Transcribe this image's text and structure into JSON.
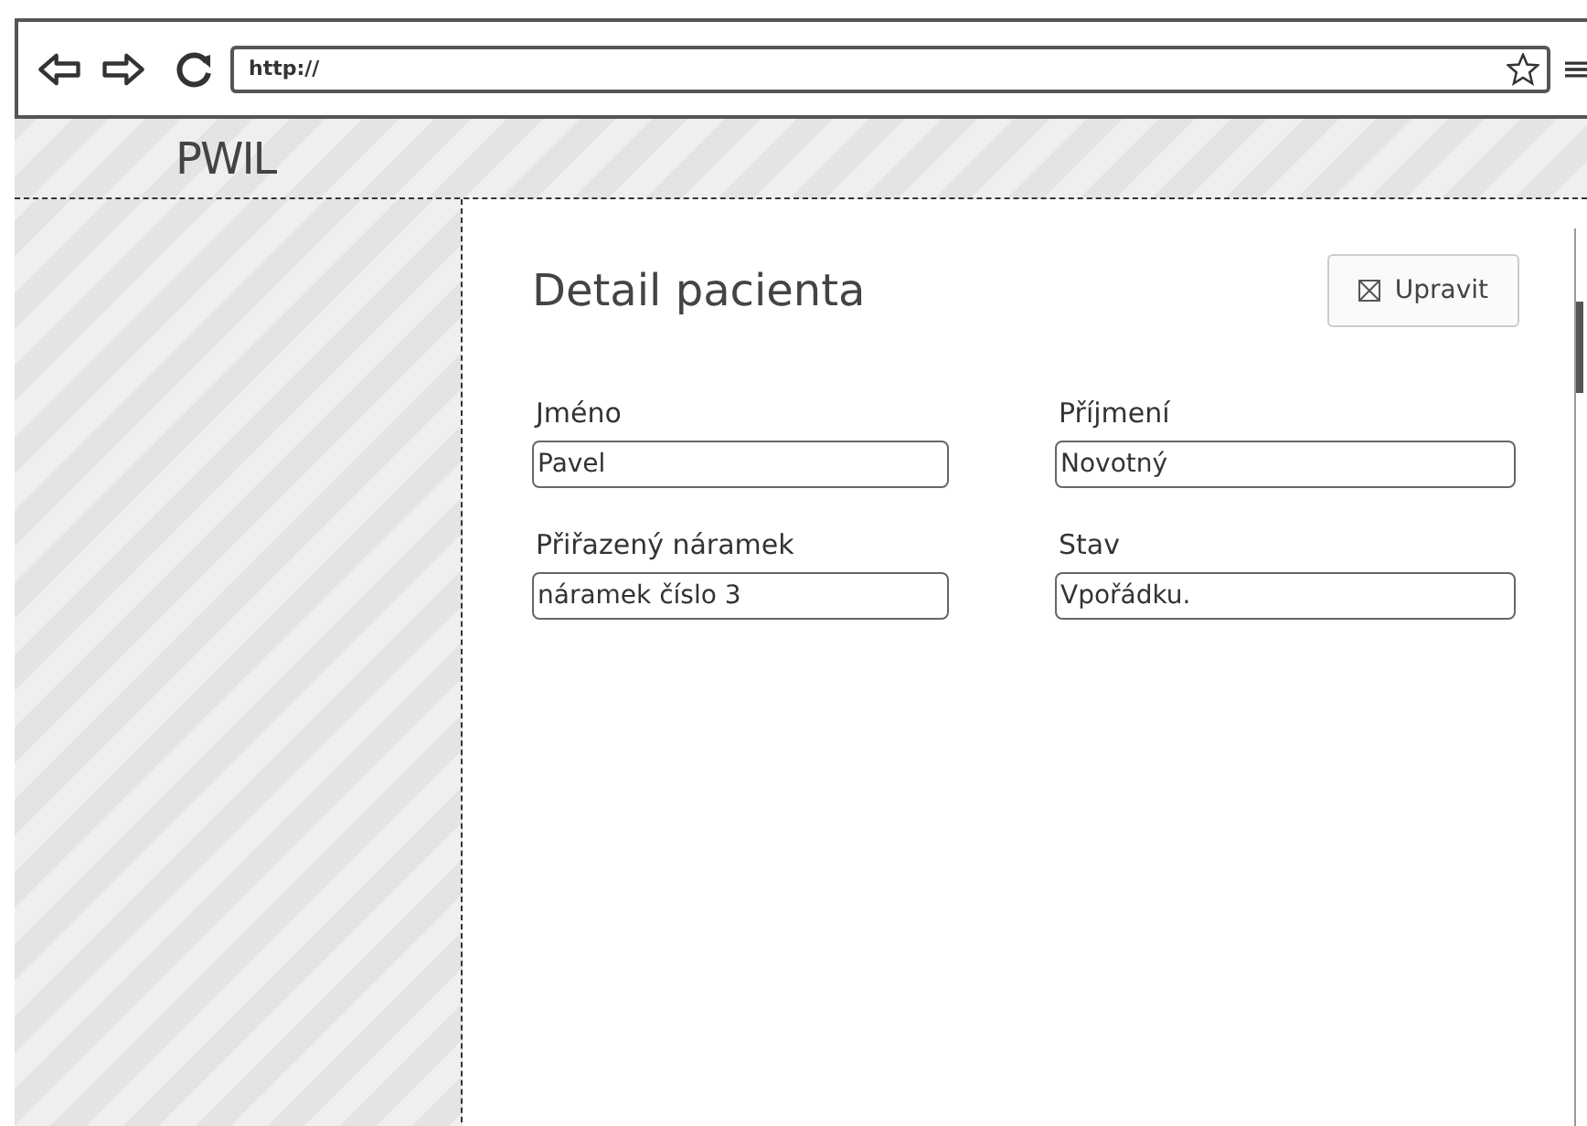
{
  "browser": {
    "url": "http://"
  },
  "header": {
    "logo": "PWIL"
  },
  "page": {
    "title": "Detail pacienta",
    "edit_button": "Upravit",
    "fields": [
      {
        "label": "Jméno",
        "value": "Pavel"
      },
      {
        "label": "Příjmení",
        "value": "Novotný"
      },
      {
        "label": "Přiřazený náramek",
        "value": "náramek číslo 3"
      },
      {
        "label": "Stav",
        "value": "Vpořádku."
      }
    ]
  }
}
